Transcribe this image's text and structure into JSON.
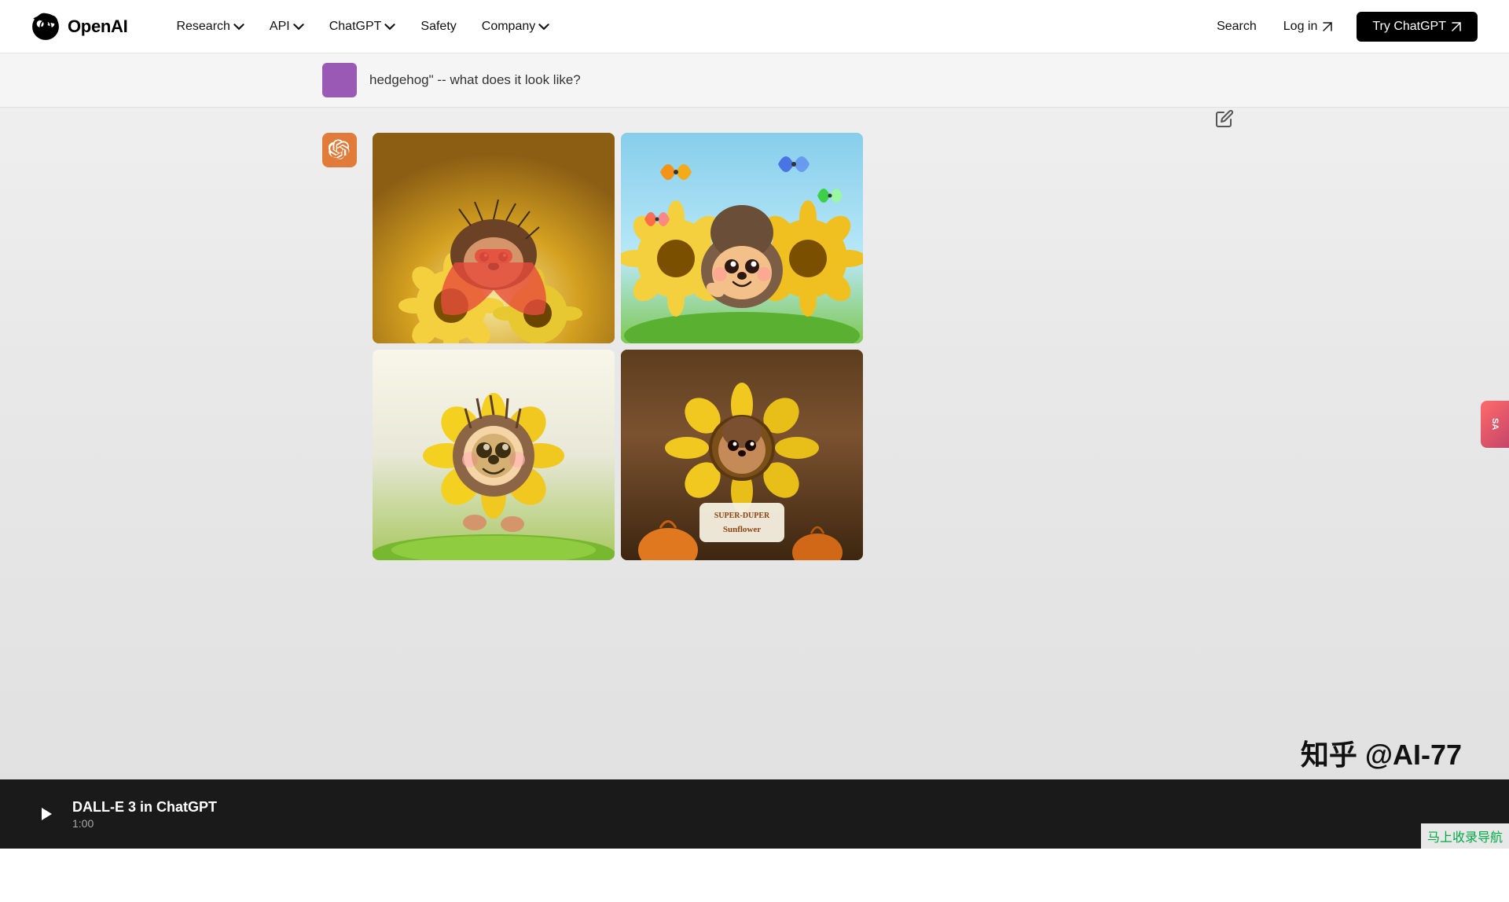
{
  "navbar": {
    "logo_text": "OpenAI",
    "links": [
      {
        "label": "Research",
        "has_dropdown": true
      },
      {
        "label": "API",
        "has_dropdown": true
      },
      {
        "label": "ChatGPT",
        "has_dropdown": true
      },
      {
        "label": "Safety",
        "has_dropdown": false
      },
      {
        "label": "Company",
        "has_dropdown": true
      }
    ],
    "search_label": "Search",
    "login_label": "Log in",
    "try_label": "Try ChatGPT"
  },
  "chat": {
    "user_message": "hedgehog\" -- what does it look like?",
    "ai_avatar_alt": "ChatGPT Logo",
    "images": [
      {
        "alt": "Hedgehog superhero with sunflowers",
        "id": "img1"
      },
      {
        "alt": "Cartoon hedgehog with sunflowers and butterflies",
        "id": "img2"
      },
      {
        "alt": "Cartoon hedgehog with sunflower",
        "id": "img3"
      },
      {
        "alt": "Hedgehog in sunflower pot",
        "id": "img4"
      }
    ]
  },
  "video": {
    "title": "DALL-E 3 in ChatGPT",
    "time": "1:00"
  },
  "watermarks": {
    "right": "知乎 @AI-77",
    "bottom": "马上收录导航"
  },
  "side_float": {
    "label": "SA"
  }
}
